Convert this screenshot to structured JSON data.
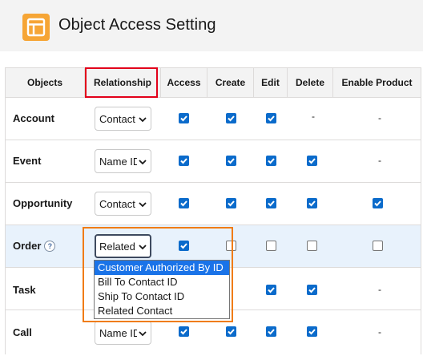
{
  "header": {
    "title": "Object Access Setting",
    "icon": "layout-icon",
    "icon_color": "#f6a535"
  },
  "columns": [
    "Objects",
    "Relationship",
    "Access",
    "Create",
    "Edit",
    "Delete",
    "Enable Product"
  ],
  "rows": [
    {
      "object": "Account",
      "relationship": "Contact",
      "access": true,
      "create": true,
      "edit": true,
      "delete": "-",
      "enable_product": "-"
    },
    {
      "object": "Event",
      "relationship": "Name ID",
      "access": true,
      "create": true,
      "edit": true,
      "delete": true,
      "enable_product": "-"
    },
    {
      "object": "Opportunity",
      "relationship": "Contact",
      "access": true,
      "create": true,
      "edit": true,
      "delete": true,
      "enable_product": true
    },
    {
      "object": "Order",
      "relationship": "Related",
      "access": true,
      "create": false,
      "edit": false,
      "delete": false,
      "enable_product": false,
      "has_help": true,
      "help_glyph": "?"
    },
    {
      "object": "Task",
      "relationship": "",
      "access": null,
      "create": null,
      "edit": true,
      "delete": true,
      "enable_product": "-"
    },
    {
      "object": "Call",
      "relationship": "Name ID",
      "access": true,
      "create": true,
      "edit": true,
      "delete": true,
      "enable_product": "-"
    }
  ],
  "relationship_dropdown": {
    "open_on_row": "Order",
    "options": [
      "Customer Authorized By ID",
      "Bill To Contact ID",
      "Ship To Contact ID",
      "Related Contact"
    ],
    "highlighted": "Customer Authorized By ID"
  },
  "colors": {
    "checkbox": "#0b6bcb",
    "highlight_row": "#e8f2fc",
    "annotation_red": "#e2001a",
    "annotation_orange": "#f07c14",
    "dropdown_selected": "#1a73e8"
  }
}
